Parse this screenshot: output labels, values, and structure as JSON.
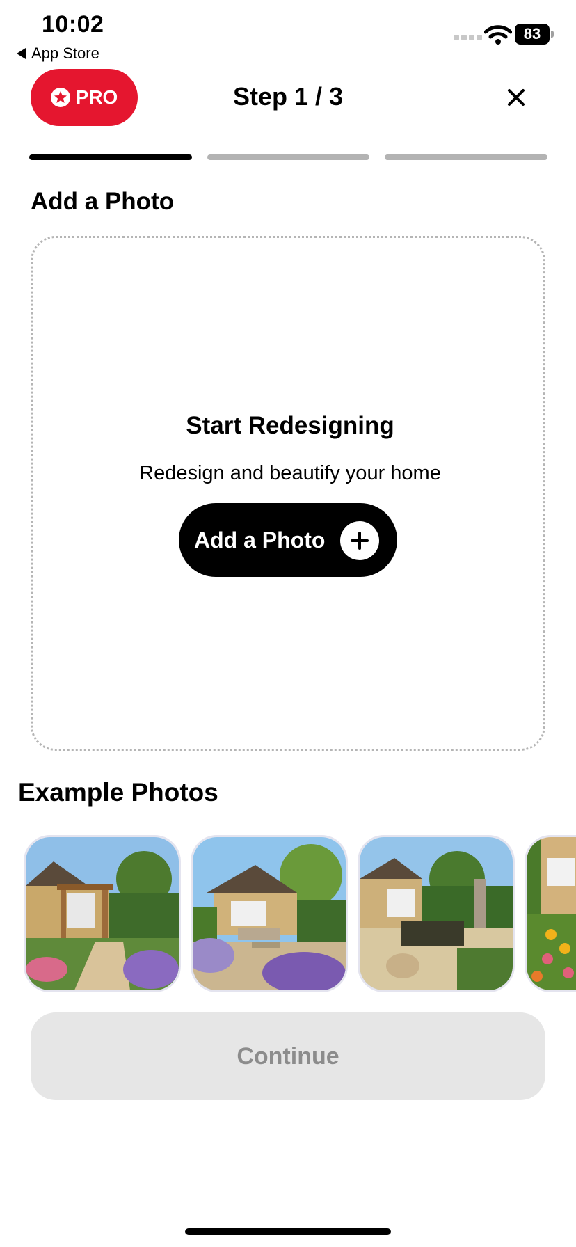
{
  "status_bar": {
    "time": "10:02",
    "back_label": "App Store",
    "battery": "83"
  },
  "header": {
    "pro_label": "PRO",
    "step": "Step 1 / 3"
  },
  "progress": {
    "current_step": 1,
    "total_steps": 3,
    "active_color": "#000000",
    "inactive_color": "#b3b3b3"
  },
  "upload": {
    "section_title": "Add a Photo",
    "heading": "Start Redesigning",
    "subtitle": "Redesign and beautify your home",
    "button_label": "Add a Photo"
  },
  "examples": {
    "title": "Example Photos",
    "photos": [
      "garden-pergola",
      "garden-patio-bench",
      "zen-garden-pond",
      "cottage-flower-garden"
    ]
  },
  "footer": {
    "continue_label": "Continue"
  },
  "colors": {
    "brand_red": "#e5162f",
    "disabled_bg": "#e6e6e6",
    "disabled_text": "#8c8c8c"
  }
}
